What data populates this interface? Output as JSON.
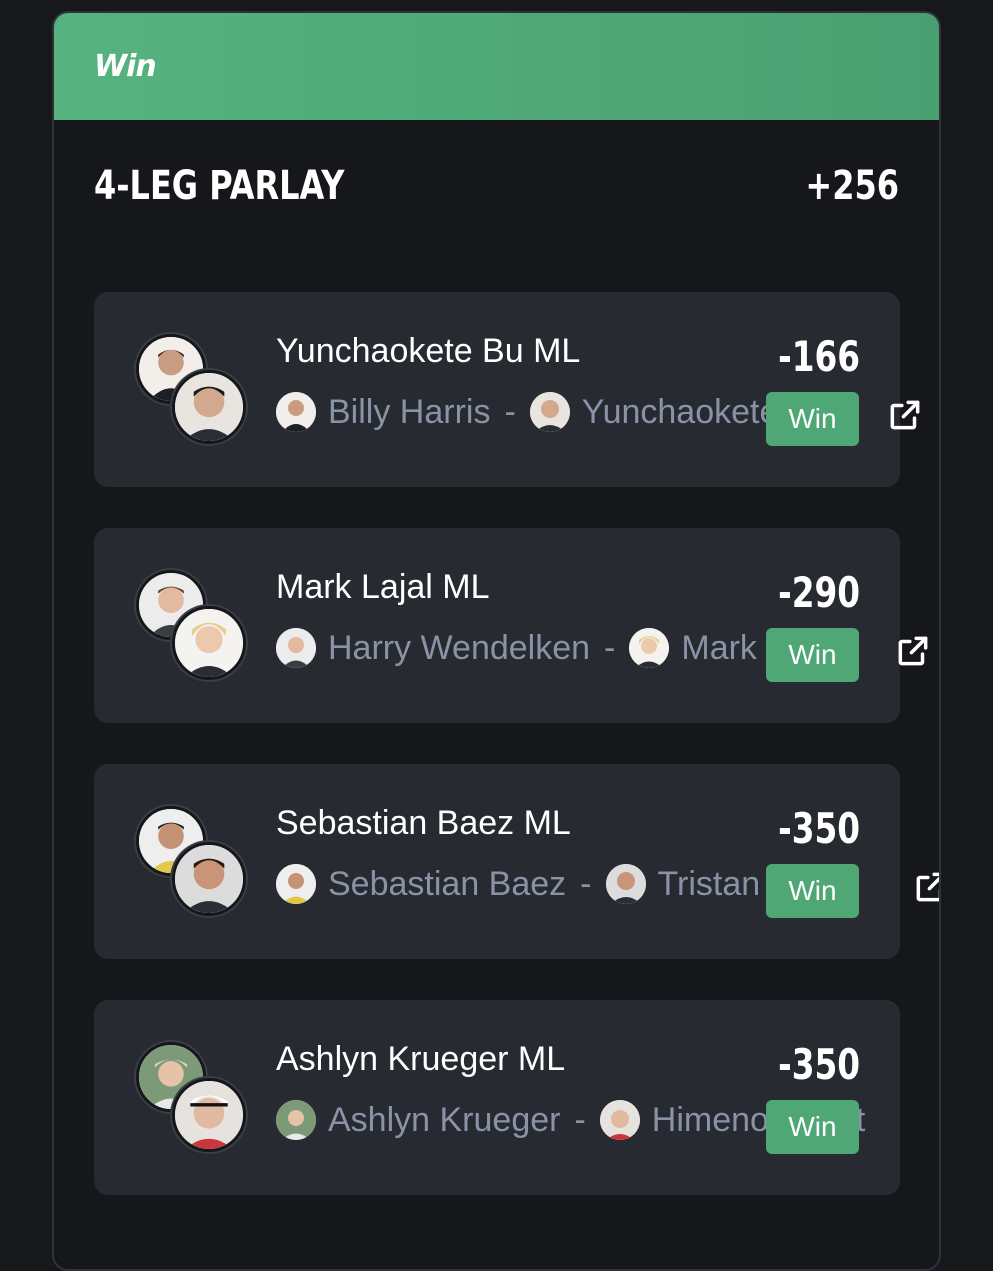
{
  "header": {
    "logo": "Win"
  },
  "parlay": {
    "title": "4-LEG PARLAY",
    "odds": "+256"
  },
  "legs": [
    {
      "title": "Yunchaokete Bu ML",
      "player1": "Billy Harris",
      "separator": "-",
      "player2": "Yunchaokete Bu",
      "odds": "-166",
      "status": "Win",
      "icon": "external-link-icon"
    },
    {
      "title": "Mark Lajal ML",
      "player1": "Harry Wendelken",
      "separator": "-",
      "player2": "Mark Lajal",
      "odds": "-290",
      "status": "Win",
      "icon": "external-link-icon"
    },
    {
      "title": "Sebastian Baez ML",
      "player1": "Sebastian Baez",
      "separator": "-",
      "player2": "Tristan Boyer",
      "odds": "-350",
      "status": "Win",
      "icon": "external-link-icon"
    },
    {
      "title": "Ashlyn Krueger ML",
      "player1": "Ashlyn Krueger",
      "separator": "-",
      "player2": "Himeno Sakatsume",
      "odds": "-350",
      "status": "Win",
      "icon": "external-link-icon"
    }
  ],
  "colors": {
    "header_green": "#56b37f",
    "win_green": "#4ea774",
    "card_bg": "#272a31",
    "muted_text": "#8a93a6"
  }
}
